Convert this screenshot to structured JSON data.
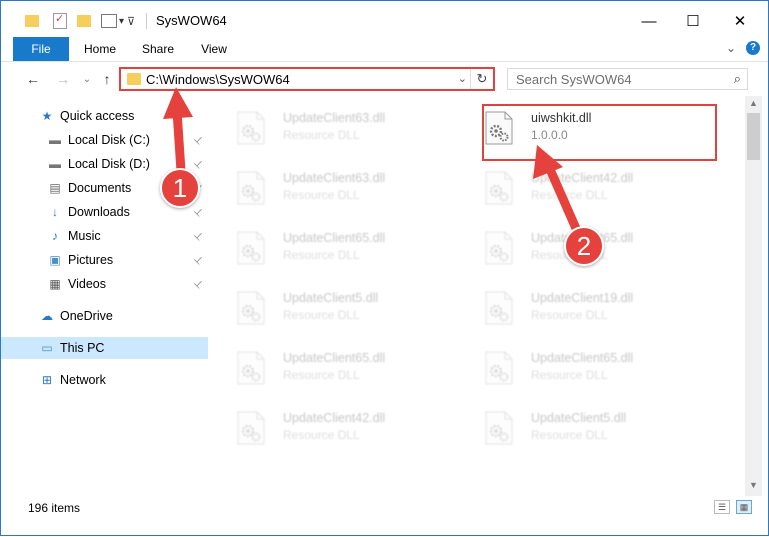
{
  "window": {
    "title": "SysWOW64"
  },
  "controls": {
    "minimize": "—",
    "maximize": "☐",
    "close": "✕"
  },
  "ribbon": {
    "tabs": [
      "File",
      "Home",
      "Share",
      "View"
    ],
    "expand_glyph": "⌄",
    "help_glyph": "?"
  },
  "nav": {
    "back": "←",
    "forward": "→",
    "recent": "⌄",
    "up": "↑"
  },
  "address": {
    "path": "C:\\Windows\\SysWOW64",
    "dropdown": "⌄",
    "refresh": "↻"
  },
  "search": {
    "placeholder": "Search SysWOW64",
    "icon": "⌕"
  },
  "sidebar": {
    "items": [
      {
        "label": "Quick access",
        "icon": "star-icon",
        "glyph": "★",
        "pinned": false
      },
      {
        "label": "Local Disk (C:)",
        "icon": "drive-icon",
        "glyph": "▬",
        "pinned": true
      },
      {
        "label": "Local Disk (D:)",
        "icon": "drive-icon",
        "glyph": "▬",
        "pinned": true
      },
      {
        "label": "Documents",
        "icon": "documents-icon",
        "glyph": "▤",
        "pinned": true
      },
      {
        "label": "Downloads",
        "icon": "downloads-icon",
        "glyph": "↓",
        "pinned": true
      },
      {
        "label": "Music",
        "icon": "music-icon",
        "glyph": "♪",
        "pinned": true
      },
      {
        "label": "Pictures",
        "icon": "pictures-icon",
        "glyph": "▣",
        "pinned": true
      },
      {
        "label": "Videos",
        "icon": "videos-icon",
        "glyph": "▦",
        "pinned": true
      },
      {
        "label": "OneDrive",
        "icon": "cloud-icon",
        "glyph": "☁",
        "pinned": false
      },
      {
        "label": "This PC",
        "icon": "computer-icon",
        "glyph": "▭",
        "pinned": false,
        "selected": true
      },
      {
        "label": "Network",
        "icon": "network-icon",
        "glyph": "⊞",
        "pinned": false
      }
    ],
    "pin_glyph": "📌"
  },
  "files": [
    {
      "name": "UpdateClient63.dll",
      "type": "Resource DLL",
      "faded": true
    },
    {
      "name": "uiwshkit.dll",
      "type": "1.0.0.0",
      "faded": false
    },
    {
      "name": "UpdateClient63.dll",
      "type": "Resource DLL",
      "faded": true
    },
    {
      "name": "UpdateClient42.dll",
      "type": "Resource DLL",
      "faded": true
    },
    {
      "name": "UpdateClient65.dll",
      "type": "Resource DLL",
      "faded": true
    },
    {
      "name": "UpdateClient65.dll",
      "type": "Resource DLL",
      "faded": true
    },
    {
      "name": "UpdateClient5.dll",
      "type": "Resource DLL",
      "faded": true
    },
    {
      "name": "UpdateClient19.dll",
      "type": "Resource DLL",
      "faded": true
    },
    {
      "name": "UpdateClient65.dll",
      "type": "Resource DLL",
      "faded": true
    },
    {
      "name": "UpdateClient65.dll",
      "type": "Resource DLL",
      "faded": true
    },
    {
      "name": "UpdateClient42.dll",
      "type": "Resource DLL",
      "faded": true
    },
    {
      "name": "UpdateClient5.dll",
      "type": "Resource DLL",
      "faded": true
    }
  ],
  "status": {
    "item_count": "196 items"
  },
  "callouts": {
    "step1": "1",
    "step2": "2"
  },
  "colors": {
    "accent": "#1979ca",
    "highlight": "#e0433d",
    "selected_bg": "#cce8ff"
  }
}
